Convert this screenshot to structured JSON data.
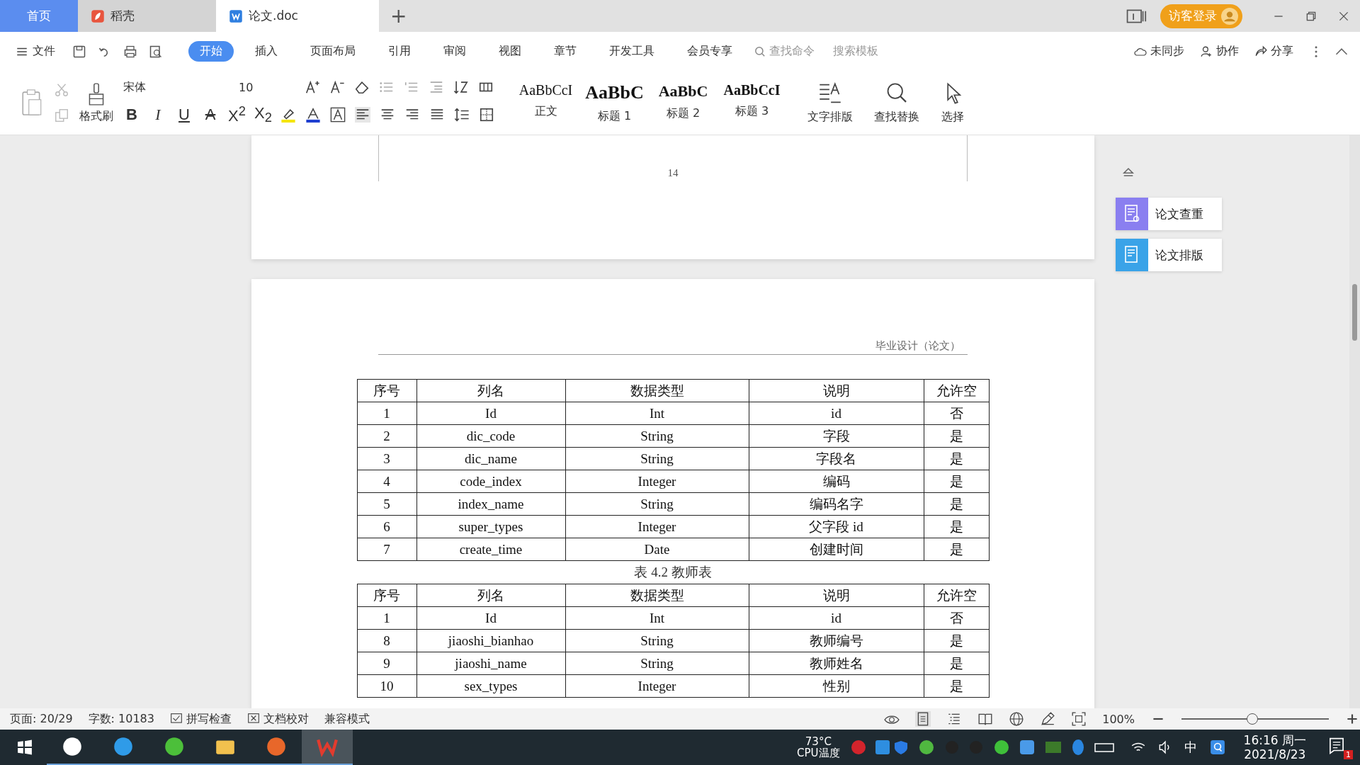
{
  "tabs": [
    {
      "label": "首页",
      "kind": "home",
      "selected": false
    },
    {
      "label": "稻壳",
      "kind": "docer",
      "selected": false
    },
    {
      "label": "论文.doc",
      "kind": "doc",
      "selected": true
    }
  ],
  "new_tab": "+",
  "login": "访客登录",
  "menu": {
    "file": "文件",
    "items": [
      {
        "label": "开始",
        "selected": true
      },
      {
        "label": "插入",
        "selected": false
      },
      {
        "label": "页面布局",
        "selected": false
      },
      {
        "label": "引用",
        "selected": false
      },
      {
        "label": "审阅",
        "selected": false
      },
      {
        "label": "视图",
        "selected": false
      },
      {
        "label": "章节",
        "selected": false
      },
      {
        "label": "开发工具",
        "selected": false
      },
      {
        "label": "会员专享",
        "selected": false
      }
    ],
    "search": "查找命令",
    "template_search": "搜索模板",
    "actions": [
      {
        "label": "未同步",
        "kind": "sync"
      },
      {
        "label": "协作",
        "kind": "collab"
      },
      {
        "label": "分享",
        "kind": "share"
      }
    ]
  },
  "ribbon": {
    "format_painter": "格式刷",
    "font": "宋体",
    "font_size": "10",
    "format_buttons": [
      {
        "label": "B",
        "kind": "bold"
      },
      {
        "label": "I",
        "kind": "italic"
      },
      {
        "label": "U",
        "kind": "underline"
      },
      {
        "label": "A",
        "kind": "strike"
      },
      {
        "label": "X$^{2}$",
        "kind": "sup"
      },
      {
        "label": "X$_{2}$",
        "kind": "sub"
      }
    ],
    "styles": [
      {
        "sample": "AaBbCcI",
        "name": "正文",
        "kind": "normal"
      },
      {
        "sample": "AaBbC",
        "name": "标题 1",
        "kind": "h1"
      },
      {
        "sample": "AaBbC",
        "name": "标题 2",
        "kind": "h2"
      },
      {
        "sample": "AaBbCcI",
        "name": "标题 3",
        "kind": "h3"
      }
    ],
    "tools": [
      {
        "label": "文字排版",
        "kind": "layout"
      },
      {
        "label": "查找替换",
        "kind": "find"
      },
      {
        "label": "选择",
        "kind": "select"
      }
    ]
  },
  "document": {
    "page_number": "14",
    "header": "毕业设计（论文）",
    "blocks": [
      {
        "kind": "table",
        "columns": [
          "序号",
          "列名",
          "数据类型",
          "说明",
          "允许空"
        ],
        "rows": [
          [
            "1",
            "Id",
            "Int",
            "id",
            "否"
          ],
          [
            "2",
            "dic_code",
            "String",
            "字段",
            "是"
          ],
          [
            "3",
            "dic_name",
            "String",
            "字段名",
            "是"
          ],
          [
            "4",
            "code_index",
            "Integer",
            "编码",
            "是"
          ],
          [
            "5",
            "index_name",
            "String",
            "编码名字",
            "是"
          ],
          [
            "6",
            "super_types",
            "Integer",
            "父字段 id",
            "是"
          ],
          [
            "7",
            "create_time",
            "Date",
            "创建时间",
            "是"
          ]
        ]
      },
      {
        "kind": "caption",
        "text": "表 4.2 教师表"
      },
      {
        "kind": "table",
        "columns": [
          "序号",
          "列名",
          "数据类型",
          "说明",
          "允许空"
        ],
        "rows": [
          [
            "1",
            "Id",
            "Int",
            "id",
            "否"
          ],
          [
            "8",
            "jiaoshi_bianhao",
            "String",
            "教师编号",
            "是"
          ],
          [
            "9",
            "jiaoshi_name",
            "String",
            "教师姓名",
            "是"
          ],
          [
            "10",
            "sex_types",
            "Integer",
            "性别",
            "是"
          ]
        ]
      }
    ]
  },
  "side_panel": [
    {
      "label": "论文查重",
      "kind": "check"
    },
    {
      "label": "论文排版",
      "kind": "format"
    }
  ],
  "status_bar": {
    "page": "页面: 20/29",
    "words": "字数: 10183",
    "toggles": [
      {
        "label": "拼写检查",
        "kind": "spell"
      },
      {
        "label": "文档校对",
        "kind": "proof"
      }
    ],
    "mode": "兼容模式",
    "zoom": "100%",
    "zoom_slider": {
      "level": 0.48
    }
  },
  "taskbar": {
    "apps": [
      {
        "kind": "pinwheel",
        "selected": false
      },
      {
        "kind": "e-browser",
        "selected": false
      },
      {
        "kind": "green-browser",
        "selected": false
      },
      {
        "kind": "folder",
        "selected": false
      },
      {
        "kind": "mascot",
        "selected": false
      },
      {
        "kind": "office",
        "selected": true
      }
    ],
    "cpu_temp": "73°C",
    "cpu_label": "CPU温度",
    "ime": "中",
    "time": "16:16 周一",
    "date": "2021/8/23",
    "notifications": "1"
  }
}
